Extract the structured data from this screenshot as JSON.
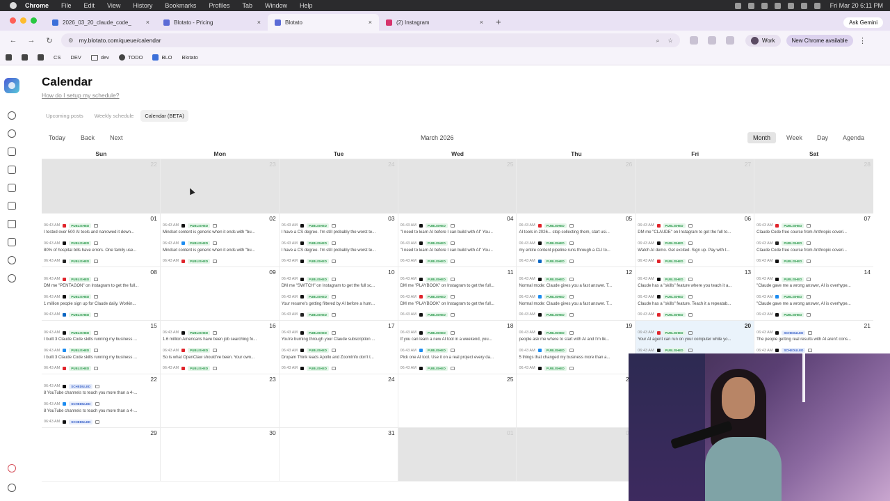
{
  "macmenu": {
    "items": [
      "Chrome",
      "File",
      "Edit",
      "View",
      "History",
      "Bookmarks",
      "Profiles",
      "Tab",
      "Window",
      "Help"
    ],
    "clock": "Fri Mar 20  6:11 PM"
  },
  "tabs": [
    {
      "title": "2026_03_20_claude_code_",
      "color": "#3b6fd9"
    },
    {
      "title": "Blotato - Pricing",
      "color": "#5b6bd6"
    },
    {
      "title": "Blotato",
      "color": "#5b6bd6"
    },
    {
      "title": "(2) Instagram",
      "color": "#d6336c"
    }
  ],
  "ask_gemini": "Ask Gemini",
  "url": "my.blotato.com/queue/calendar",
  "profile_label": "Work",
  "new_chrome_label": "New Chrome available",
  "bookmarks": [
    "CS",
    "DEV",
    "dev",
    "TODO",
    "BLO",
    "Blotato"
  ],
  "page": {
    "title": "Calendar",
    "setup_link": "How do I setup my schedule?",
    "subtabs": [
      "Upcoming posts",
      "Weekly schedule",
      "Calendar (BETA)"
    ]
  },
  "calendar": {
    "nav": {
      "today": "Today",
      "back": "Back",
      "next": "Next"
    },
    "month_label": "March 2026",
    "views": [
      "Month",
      "Week",
      "Day",
      "Agenda"
    ],
    "days_of_week": [
      "Sun",
      "Mon",
      "Tue",
      "Wed",
      "Thu",
      "Fri",
      "Sat"
    ],
    "weeks": [
      {
        "cells": [
          {
            "day": "22",
            "off": true,
            "events": []
          },
          {
            "day": "23",
            "off": true,
            "events": []
          },
          {
            "day": "24",
            "off": true,
            "events": []
          },
          {
            "day": "25",
            "off": true,
            "events": []
          },
          {
            "day": "26",
            "off": true,
            "events": []
          },
          {
            "day": "27",
            "off": true,
            "events": []
          },
          {
            "day": "28",
            "off": true,
            "events": []
          }
        ]
      },
      {
        "cells": [
          {
            "day": "01",
            "events": [
              {
                "time": "06:43 AM",
                "platform": "youtube",
                "status": "PUBLISHED",
                "text": "I tested over 500 AI tools and narrowed it down..."
              },
              {
                "time": "06:43 AM",
                "platform": "x",
                "status": "PUBLISHED",
                "text": "80% of hospital bills have errors. One family use..."
              },
              {
                "time": "06:43 AM",
                "platform": "threads",
                "status": "PUBLISHED",
                "text": ""
              }
            ]
          },
          {
            "day": "02",
            "events": [
              {
                "time": "06:43 AM",
                "platform": "x",
                "status": "PUBLISHED",
                "text": "Mindset content is generic when it ends with \"bu..."
              },
              {
                "time": "06:43 AM",
                "platform": "bluesky",
                "status": "PUBLISHED",
                "text": "Mindset content is generic when it ends with \"bu..."
              },
              {
                "time": "06:43 AM",
                "platform": "youtube",
                "status": "PUBLISHED",
                "text": ""
              }
            ]
          },
          {
            "day": "03",
            "events": [
              {
                "time": "06:43 AM",
                "platform": "x",
                "status": "PUBLISHED",
                "text": "I have a CS degree. I'm still probably the worst te..."
              },
              {
                "time": "06:43 AM",
                "platform": "x",
                "status": "PUBLISHED",
                "text": "I have a CS degree. I'm still probably the worst te..."
              },
              {
                "time": "06:43 AM",
                "platform": "x",
                "status": "PUBLISHED",
                "text": ""
              }
            ]
          },
          {
            "day": "04",
            "events": [
              {
                "time": "06:43 AM",
                "platform": "x",
                "status": "PUBLISHED",
                "text": "\"I need to learn AI before I can build with AI\" You..."
              },
              {
                "time": "06:43 AM",
                "platform": "x",
                "status": "PUBLISHED",
                "text": "\"I need to learn AI before I can build with AI\" You..."
              },
              {
                "time": "06:43 AM",
                "platform": "x",
                "status": "PUBLISHED",
                "text": ""
              }
            ]
          },
          {
            "day": "05",
            "events": [
              {
                "time": "06:43 AM",
                "platform": "youtube",
                "status": "PUBLISHED",
                "text": "AI tools in 2026... stop collecting them, start usi..."
              },
              {
                "time": "06:43 AM",
                "platform": "x",
                "status": "PUBLISHED",
                "text": "my entire content pipeline runs through a CLI to..."
              },
              {
                "time": "06:43 AM",
                "platform": "linkedin",
                "status": "PUBLISHED",
                "text": ""
              }
            ]
          },
          {
            "day": "06",
            "events": [
              {
                "time": "06:43 AM",
                "platform": "youtube",
                "status": "PUBLISHED",
                "text": "DM me \"CLAUDE\" on Instagram to get the full to..."
              },
              {
                "time": "06:43 AM",
                "platform": "x",
                "status": "PUBLISHED",
                "text": "Watch AI demo. Get excited. Sign up. Pay with t..."
              },
              {
                "time": "06:43 AM",
                "platform": "youtube",
                "status": "PUBLISHED",
                "text": ""
              }
            ]
          },
          {
            "day": "07",
            "events": [
              {
                "time": "06:43 AM",
                "platform": "youtube",
                "status": "PUBLISHED",
                "text": "Claude Code free course from Anthropic coveri..."
              },
              {
                "time": "06:43 AM",
                "platform": "threads",
                "status": "PUBLISHED",
                "text": "Claude Code free course from Anthropic coveri..."
              },
              {
                "time": "06:43 AM",
                "platform": "x",
                "status": "PUBLISHED",
                "text": ""
              }
            ]
          }
        ]
      },
      {
        "cells": [
          {
            "day": "08",
            "events": [
              {
                "time": "06:43 AM",
                "platform": "youtube",
                "status": "PUBLISHED",
                "text": "DM me \"PENTAGON\" on Instagram to get the full..."
              },
              {
                "time": "06:43 AM",
                "platform": "x",
                "status": "PUBLISHED",
                "text": "1 million people sign up for Claude daily. Workin..."
              },
              {
                "time": "06:43 AM",
                "platform": "linkedin",
                "status": "PUBLISHED",
                "text": ""
              }
            ]
          },
          {
            "day": "09",
            "events": []
          },
          {
            "day": "10",
            "events": [
              {
                "time": "06:43 AM",
                "platform": "x",
                "status": "PUBLISHED",
                "text": "DM me \"SWITCH\" on Instagram to get the full sc..."
              },
              {
                "time": "06:43 AM",
                "platform": "x",
                "status": "PUBLISHED",
                "text": "Your resume's getting filtered by AI before a hum..."
              },
              {
                "time": "06:43 AM",
                "platform": "threads",
                "status": "PUBLISHED",
                "text": ""
              }
            ]
          },
          {
            "day": "11",
            "events": [
              {
                "time": "06:43 AM",
                "platform": "x",
                "status": "PUBLISHED",
                "text": "DM me \"PLAYBOOK\" on Instagram to get the full..."
              },
              {
                "time": "06:43 AM",
                "platform": "youtube",
                "status": "PUBLISHED",
                "text": "DM me \"PLAYBOOK\" on Instagram to get the full..."
              },
              {
                "time": "06:43 AM",
                "platform": "x",
                "status": "PUBLISHED",
                "text": ""
              }
            ]
          },
          {
            "day": "12",
            "events": [
              {
                "time": "06:43 AM",
                "platform": "x",
                "status": "PUBLISHED",
                "text": "Normal mode: Claude gives you a fast answer. T..."
              },
              {
                "time": "06:43 AM",
                "platform": "bluesky",
                "status": "PUBLISHED",
                "text": "Normal mode: Claude gives you a fast answer. T..."
              },
              {
                "time": "06:43 AM",
                "platform": "x",
                "status": "PUBLISHED",
                "text": ""
              }
            ]
          },
          {
            "day": "13",
            "events": [
              {
                "time": "06:43 AM",
                "platform": "x",
                "status": "PUBLISHED",
                "text": "Claude has a \"skills\" feature where you teach it a..."
              },
              {
                "time": "06:43 AM",
                "platform": "x",
                "status": "PUBLISHED",
                "text": "Claude has a \"skills\" feature. Teach it a repeatab..."
              },
              {
                "time": "06:43 AM",
                "platform": "youtube",
                "status": "PUBLISHED",
                "text": ""
              }
            ]
          },
          {
            "day": "14",
            "events": [
              {
                "time": "06:43 AM",
                "platform": "x",
                "status": "PUBLISHED",
                "text": "\"Claude gave me a wrong answer, AI is overhype..."
              },
              {
                "time": "06:43 AM",
                "platform": "bluesky",
                "status": "PUBLISHED",
                "text": "\"Claude gave me a wrong answer, AI is overhype..."
              },
              {
                "time": "06:43 AM",
                "platform": "x",
                "status": "PUBLISHED",
                "text": ""
              }
            ]
          }
        ]
      },
      {
        "cells": [
          {
            "day": "15",
            "events": [
              {
                "time": "06:43 AM",
                "platform": "x",
                "status": "PUBLISHED",
                "text": "I built 3 Claude Code skills running my business ..."
              },
              {
                "time": "06:43 AM",
                "platform": "bluesky",
                "status": "PUBLISHED",
                "text": "I built 3 Claude Code skills running my business ..."
              },
              {
                "time": "06:43 AM",
                "platform": "youtube",
                "status": "PUBLISHED",
                "text": ""
              }
            ]
          },
          {
            "day": "16",
            "events": [
              {
                "time": "06:43 AM",
                "platform": "x",
                "status": "PUBLISHED",
                "text": "1.6 million Americans have been job searching fo..."
              },
              {
                "time": "06:43 AM",
                "platform": "youtube",
                "status": "PUBLISHED",
                "text": "So is what OpenClaw should've been. Your own..."
              },
              {
                "time": "06:43 AM",
                "platform": "youtube",
                "status": "PUBLISHED",
                "text": ""
              }
            ]
          },
          {
            "day": "17",
            "events": [
              {
                "time": "06:43 AM",
                "platform": "x",
                "status": "PUBLISHED",
                "text": "You're burning through your Claude subscription ..."
              },
              {
                "time": "06:43 AM",
                "platform": "x",
                "status": "PUBLISHED",
                "text": "Dropam Think leads Apollo and ZoomInfo don't t..."
              },
              {
                "time": "06:43 AM",
                "platform": "x",
                "status": "PUBLISHED",
                "text": ""
              }
            ]
          },
          {
            "day": "18",
            "events": [
              {
                "time": "06:43 AM",
                "platform": "x",
                "status": "PUBLISHED",
                "text": "If you can learn a new AI tool in a weekend, you..."
              },
              {
                "time": "06:43 AM",
                "platform": "bluesky",
                "status": "PUBLISHED",
                "text": "Pick one AI tool. Use it on a real project every da..."
              },
              {
                "time": "06:43 AM",
                "platform": "x",
                "status": "PUBLISHED",
                "text": ""
              }
            ]
          },
          {
            "day": "19",
            "events": [
              {
                "time": "06:43 AM",
                "platform": "x",
                "status": "PUBLISHED",
                "text": "people ask me where to start with AI and I'm lik..."
              },
              {
                "time": "06:43 AM",
                "platform": "bluesky",
                "status": "PUBLISHED",
                "text": "5 things that changed my business more than a..."
              },
              {
                "time": "06:43 AM",
                "platform": "x",
                "status": "PUBLISHED",
                "text": ""
              }
            ]
          },
          {
            "day": "20",
            "today": true,
            "events": [
              {
                "time": "06:43 AM",
                "platform": "youtube",
                "status": "PUBLISHED",
                "text": "Your AI agent can run on your computer while yo..."
              },
              {
                "time": "06:43 AM",
                "platform": "x",
                "status": "PUBLISHED",
                "text": ""
              }
            ]
          },
          {
            "day": "21",
            "events": [
              {
                "time": "06:43 AM",
                "platform": "x",
                "status": "SCHEDULED",
                "text": "The people getting real results with AI aren't cons..."
              },
              {
                "time": "06:43 AM",
                "platform": "x",
                "status": "SCHEDULED",
                "text": ""
              }
            ]
          }
        ]
      },
      {
        "cells": [
          {
            "day": "22",
            "events": [
              {
                "time": "06:43 AM",
                "platform": "x",
                "status": "SCHEDULED",
                "text": "8 YouTube channels to teach you more than a 4-..."
              },
              {
                "time": "06:43 AM",
                "platform": "bluesky",
                "status": "SCHEDULED",
                "text": "8 YouTube channels to teach you more than a 4-..."
              },
              {
                "time": "06:43 AM",
                "platform": "x",
                "status": "SCHEDULED",
                "text": ""
              }
            ]
          },
          {
            "day": "23",
            "events": []
          },
          {
            "day": "24",
            "events": []
          },
          {
            "day": "25",
            "events": []
          },
          {
            "day": "26",
            "events": []
          },
          {
            "day": "27",
            "events": []
          },
          {
            "day": "28",
            "events": []
          }
        ]
      },
      {
        "cells": [
          {
            "day": "29",
            "events": []
          },
          {
            "day": "30",
            "events": []
          },
          {
            "day": "31",
            "events": []
          },
          {
            "day": "01",
            "off": true,
            "events": []
          },
          {
            "day": "02",
            "off": true,
            "events": []
          },
          {
            "day": "03",
            "off": true,
            "events": []
          },
          {
            "day": "04",
            "off": true,
            "events": []
          }
        ]
      }
    ]
  },
  "platform_colors": {
    "youtube": "#e0242b",
    "x": "#111111",
    "bluesky": "#1d8cf0",
    "threads": "#222222",
    "linkedin": "#0a66c2"
  }
}
